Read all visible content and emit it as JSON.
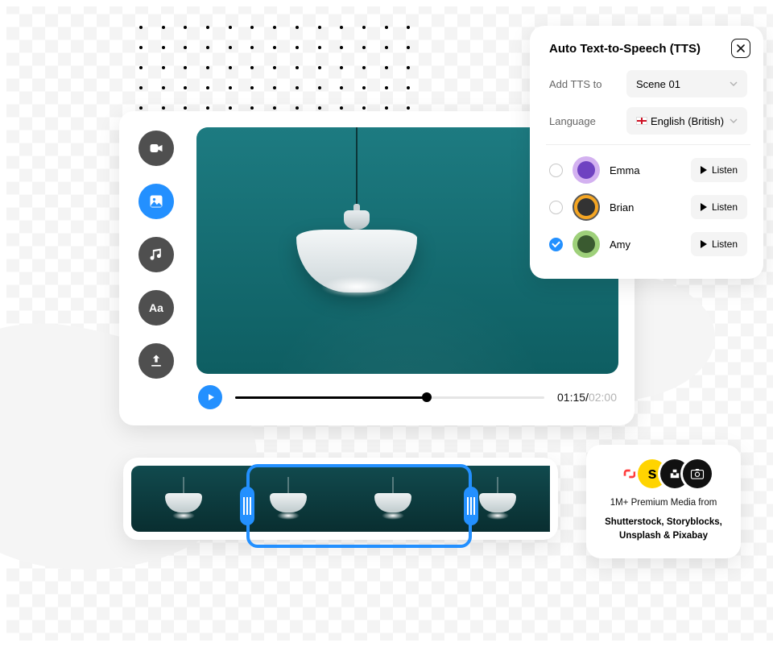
{
  "rail": {
    "items": [
      {
        "name": "video-icon",
        "active": false
      },
      {
        "name": "image-icon",
        "active": true
      },
      {
        "name": "music-icon",
        "active": false
      },
      {
        "name": "text-icon",
        "active": false
      },
      {
        "name": "upload-icon",
        "active": false
      }
    ]
  },
  "player": {
    "progress_pct": 62,
    "elapsed": "01:15",
    "total": "02:00"
  },
  "tts": {
    "title": "Auto Text-to-Speech (TTS)",
    "add_to_label": "Add TTS to",
    "add_to_value": "Scene 01",
    "lang_label": "Language",
    "lang_value": "English (British)",
    "listen_label": "Listen",
    "voices": [
      {
        "name": "Emma",
        "avatar": "purple",
        "selected": false
      },
      {
        "name": "Brian",
        "avatar": "orange",
        "selected": false
      },
      {
        "name": "Amy",
        "avatar": "green",
        "selected": true
      }
    ]
  },
  "media_card": {
    "line1": "1M+ Premium Media from",
    "line2": "Shutterstock, Storyblocks, Unsplash & Pixabay"
  }
}
